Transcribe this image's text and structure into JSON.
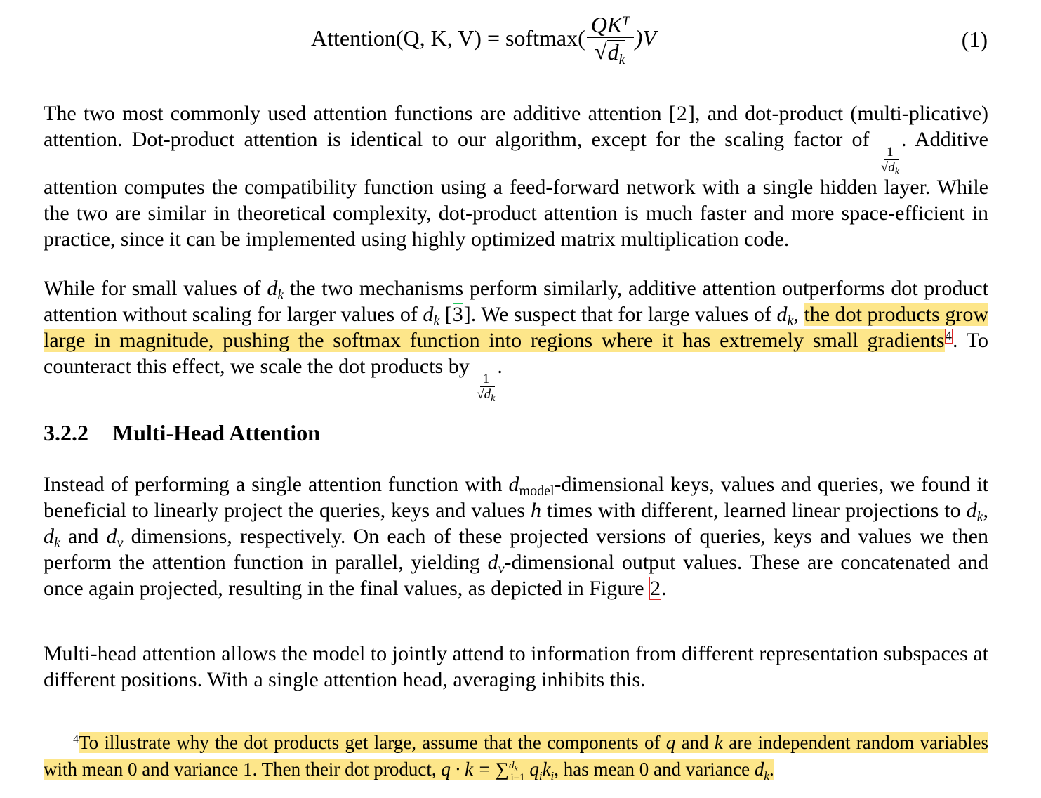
{
  "equation": {
    "lhs": "Attention(Q, K, V) = softmax(",
    "numerator": "QK",
    "numerator_sup": "T",
    "denominator_var": "d",
    "denominator_sub": "k",
    "rhs": ")V",
    "number": "(1)"
  },
  "para1": {
    "t1": "The two most commonly used attention functions are additive attention [",
    "cite1": "2",
    "t2": "], and dot-product (multi-plicative) attention. Dot-product attention is identical to our algorithm, except for the scaling factor of ",
    "frac_num": "1",
    "t3": ". Additive attention computes the compatibility function using a feed-forward network with a single hidden layer. While the two are similar in theoretical complexity, dot-product attention is much faster and more space-efficient in practice, since it can be implemented using highly optimized matrix multiplication code."
  },
  "para2": {
    "t1": "While for small values of ",
    "t2": " the two mechanisms perform similarly, additive attention outperforms dot product attention without scaling for larger values of ",
    "t3": " [",
    "cite": "3",
    "t4": "]. We suspect that for large values of ",
    "t5": ", ",
    "highlight": "the dot products grow large in magnitude, pushing the softmax function into regions where it has extremely small gradients",
    "footnote_mark": "4",
    "t6": ". To counteract this effect, we scale the dot products by ",
    "frac_num": "1",
    "t7": "."
  },
  "heading": {
    "number": "3.2.2",
    "title": "Multi-Head Attention"
  },
  "para3": {
    "t1": "Instead of performing a single attention function with ",
    "dmodel_sub": "model",
    "t2": "-dimensional keys, values and queries, we found it beneficial to linearly project the queries, keys and values ",
    "h": "h",
    "t3": " times with different, learned linear projections to ",
    "t4": ", ",
    "t5": " and ",
    "t6": " dimensions, respectively. On each of these projected versions of queries, keys and values we then perform the attention function in parallel, yielding ",
    "t7": "-dimensional output values. These are concatenated and once again projected, resulting in the final values, as depicted in Figure ",
    "fig_ref": "2",
    "t8": "."
  },
  "para4": {
    "text": "Multi-head attention allows the model to jointly attend to information from different representation subspaces at different positions. With a single attention head, averaging inhibits this."
  },
  "footnote": {
    "mark": "4",
    "t1": "To illustrate why the dot products get large, assume that the components of ",
    "q": "q",
    "t2": " and ",
    "k": "k",
    "t3": " are independent random variables with mean 0 and variance 1. Then their dot product, ",
    "expr": "q · k = ",
    "sum": "∑",
    "sum_sup": "d",
    "sum_sup_sub": "k",
    "sum_sub": "i=1",
    "t4": " q",
    "t5": "k",
    "t6": ", has mean 0 and variance ",
    "t7": "."
  },
  "highlight_color": "#fde68a"
}
